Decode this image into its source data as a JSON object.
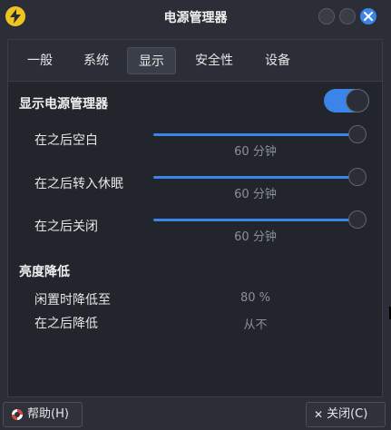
{
  "window": {
    "title": "电源管理器",
    "app_icon": "lightning-icon",
    "accent_color": "#3b84e8"
  },
  "tabs": [
    {
      "label": "一般",
      "active": false
    },
    {
      "label": "系统",
      "active": false
    },
    {
      "label": "显示",
      "active": true
    },
    {
      "label": "安全性",
      "active": false
    },
    {
      "label": "设备",
      "active": false
    }
  ],
  "display": {
    "section_title": "显示电源管理器",
    "toggle_on": true,
    "sliders": [
      {
        "label": "在之后空白",
        "value_text": "60 分钟",
        "level": 1.0
      },
      {
        "label": "在之后转入休眠",
        "value_text": "60 分钟",
        "level": 1.0
      },
      {
        "label": "在之后关闭",
        "value_text": "60 分钟",
        "level": 1.0
      }
    ]
  },
  "brightness": {
    "section_title": "亮度降低",
    "rows": [
      {
        "label": "闲置时降低至",
        "value": "80 %"
      },
      {
        "label": "在之后降低",
        "value": "从不"
      }
    ]
  },
  "footer": {
    "help_label": "帮助(H)",
    "close_label": "关闭(C)"
  }
}
